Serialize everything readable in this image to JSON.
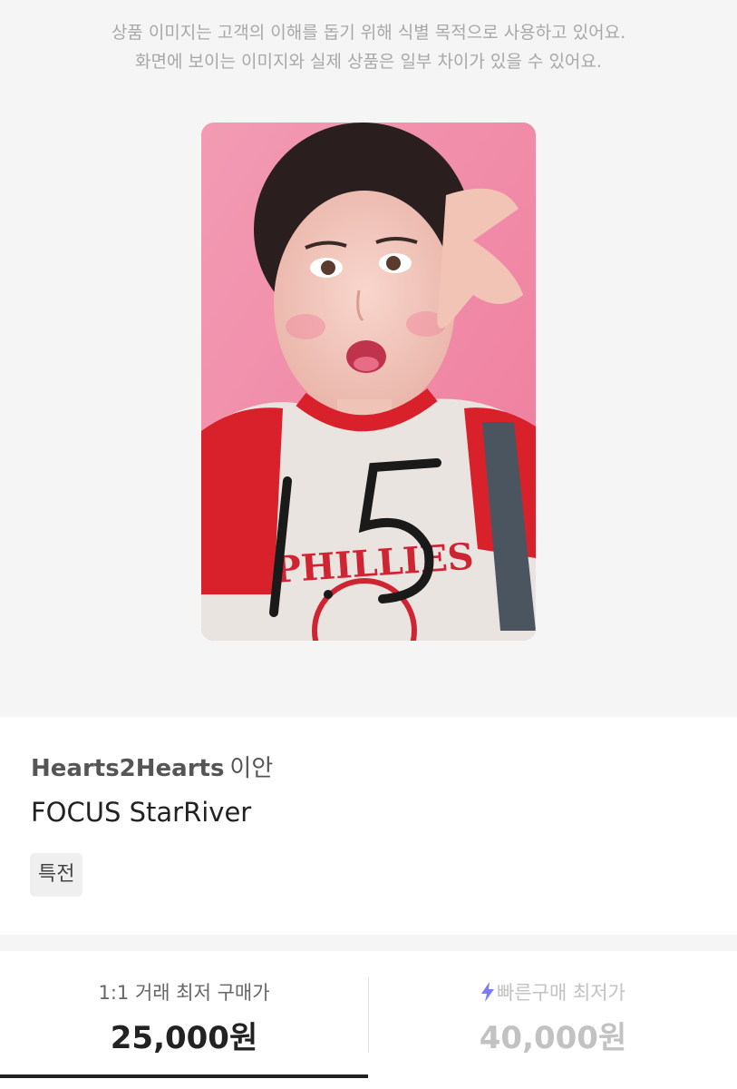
{
  "notice": {
    "line1": "상품 이미지는 고객의 이해를 돕기 위해 식별 목적으로 사용하고 있어요.",
    "line2": "화면에 보이는 이미지와 실제 상품은 일부 차이가 있을 수 있어요."
  },
  "product": {
    "group": "Hearts2Hearts",
    "member": "이안",
    "album": "FOCUS StarRiver",
    "tag": "특전",
    "photo_alt": "photocard"
  },
  "prices": {
    "direct": {
      "label": "1:1 거래 최저 구매가",
      "value": "25,000원"
    },
    "quick": {
      "label": "빠른구매 최저가",
      "value": "40,000원",
      "icon": "lightning-icon",
      "color": "#7b7ef0"
    }
  },
  "colors": {
    "background_gray": "#f5f5f5",
    "text_dark": "#222222",
    "muted": "#c2c2c2"
  }
}
